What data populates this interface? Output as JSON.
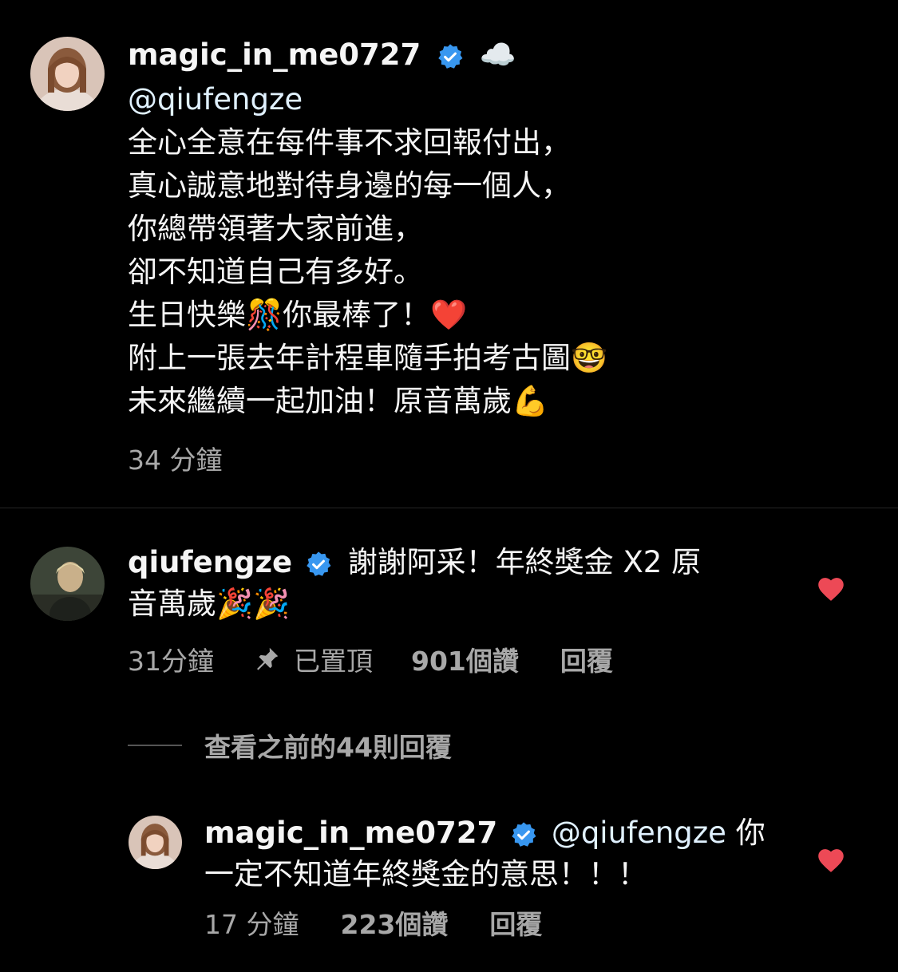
{
  "post_caption": {
    "username": "magic_in_me0727",
    "status_emoji": "☁️",
    "lines": [
      "@qiufengze",
      "全心全意在每件事不求回報付出，",
      "真心誠意地對待身邊的每一個人，",
      "你總帶領著大家前進，",
      "卻不知道自己有多好。",
      "生日快樂🎊你最棒了！❤️",
      "附上一張去年計程車隨手拍考古圖🤓",
      "未來繼續一起加油！原音萬歲💪"
    ],
    "time": "34 分鐘"
  },
  "comment": {
    "username": "qiufengze",
    "text_line1": "謝謝阿采！年終獎金 X2 原",
    "text_line2": "音萬歲🎉🎉",
    "time": "31分鐘",
    "pinned_label": "已置頂",
    "likes": "901",
    "likes_suffix": "個讚",
    "reply_label": "回覆",
    "liked": true
  },
  "view_previous_replies": "查看之前的44則回覆",
  "reply": {
    "username": "magic_in_me0727",
    "mention": "@qiufengze",
    "text_after_mention": " 你",
    "text_line2": "一定不知道年終獎金的意思！！！",
    "time": "17 分鐘",
    "likes": "223",
    "likes_suffix": "個讚",
    "reply_label": "回覆",
    "liked": true
  },
  "colors": {
    "background": "#000000",
    "secondary_text": "#a8a8a8",
    "verified_blue": "#3897f0",
    "like_red": "#ed4956"
  },
  "icons": [
    "verified-badge-icon",
    "pin-icon",
    "heart-icon"
  ]
}
